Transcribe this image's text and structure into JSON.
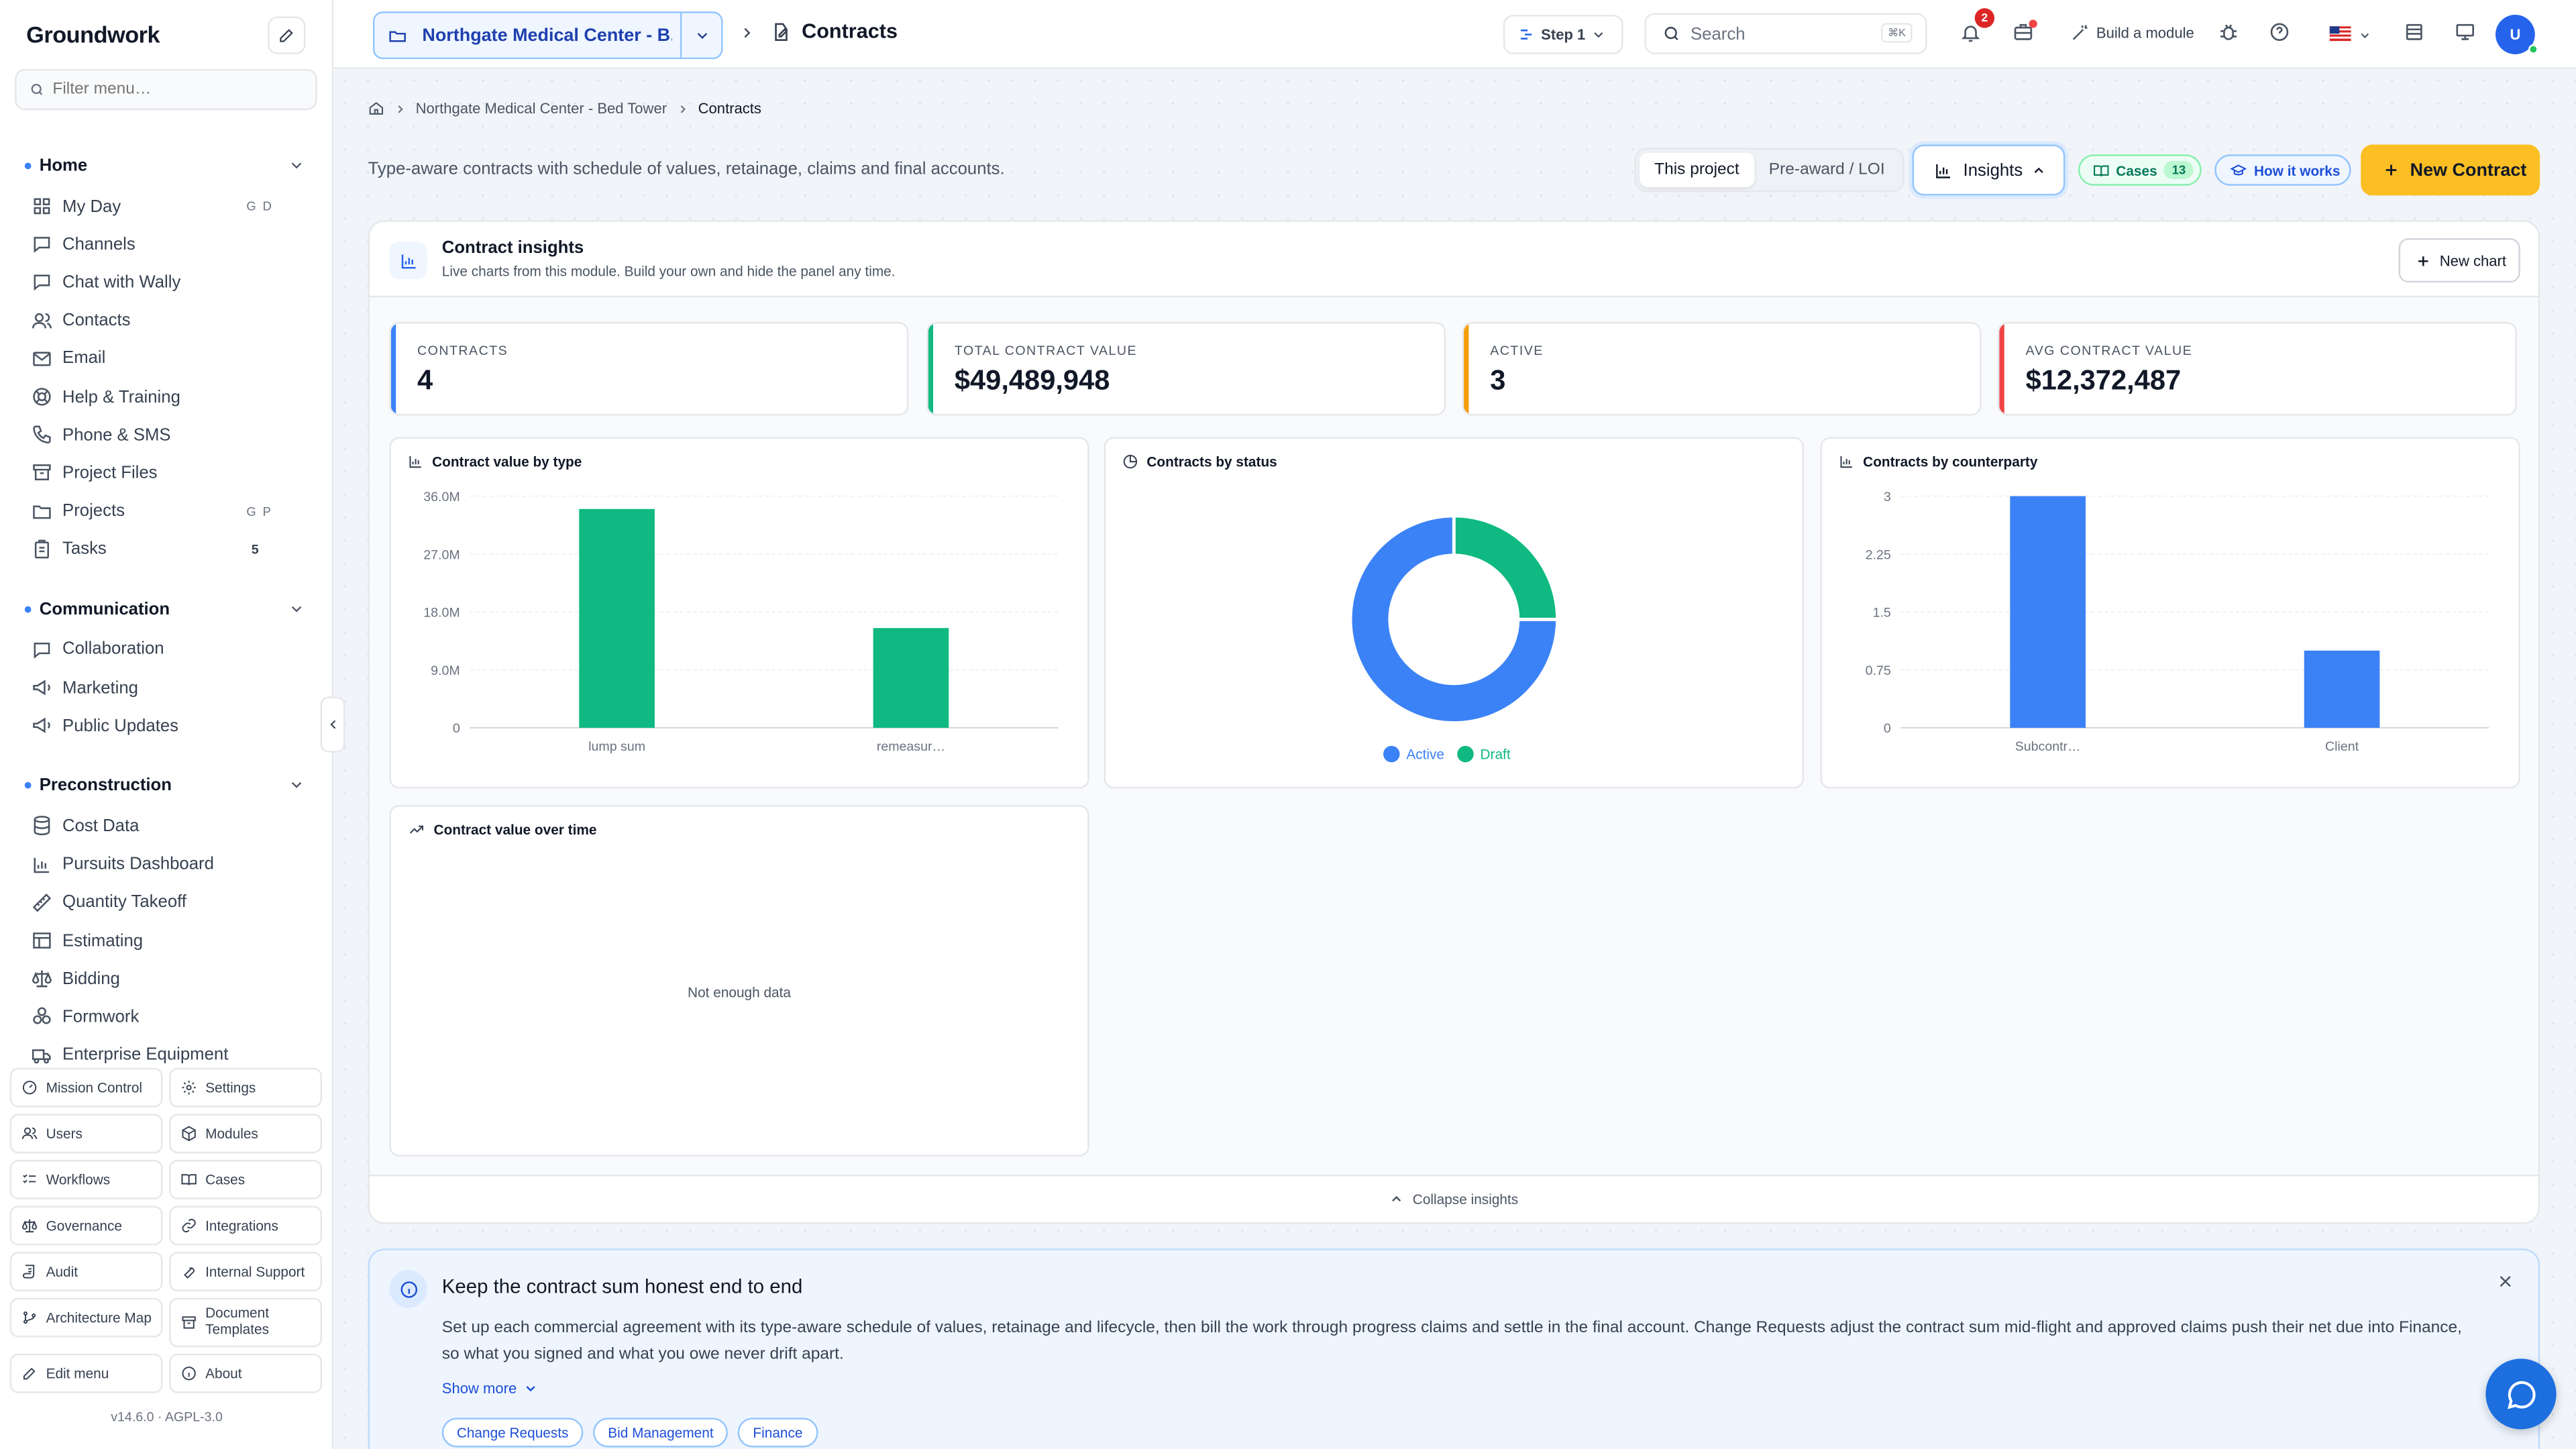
{
  "app": {
    "brand": "Groundwork",
    "version": "v14.6.0",
    "license": "AGPL-3.0"
  },
  "sidebar": {
    "filter_placeholder": "Filter menu…",
    "sections": [
      {
        "title": "Home",
        "items": [
          {
            "label": "My Day",
            "icon": "grid-icon",
            "kbd": "G D"
          },
          {
            "label": "Channels",
            "icon": "chat-icon"
          },
          {
            "label": "Chat with Wally",
            "icon": "chat-icon"
          },
          {
            "label": "Contacts",
            "icon": "users-icon"
          },
          {
            "label": "Email",
            "icon": "mail-icon"
          },
          {
            "label": "Help & Training",
            "icon": "lifebuoy-icon"
          },
          {
            "label": "Phone & SMS",
            "icon": "phone-icon"
          },
          {
            "label": "Project Files",
            "icon": "archive-icon"
          },
          {
            "label": "Projects",
            "icon": "folder-icon",
            "kbd": "G P"
          },
          {
            "label": "Tasks",
            "icon": "clipboard-icon",
            "count": "5"
          }
        ]
      },
      {
        "title": "Communication",
        "items": [
          {
            "label": "Collaboration",
            "icon": "chat-icon"
          },
          {
            "label": "Marketing",
            "icon": "megaphone-icon"
          },
          {
            "label": "Public Updates",
            "icon": "megaphone-icon"
          }
        ]
      },
      {
        "title": "Preconstruction",
        "items": [
          {
            "label": "Cost Data",
            "icon": "database-icon"
          },
          {
            "label": "Pursuits Dashboard",
            "icon": "bar-chart-icon"
          },
          {
            "label": "Quantity Takeoff",
            "icon": "ruler-icon"
          },
          {
            "label": "Estimating",
            "icon": "table-icon"
          },
          {
            "label": "Bidding",
            "icon": "scale-icon"
          },
          {
            "label": "Formwork",
            "icon": "blocks-icon"
          },
          {
            "label": "Enterprise Equipment",
            "icon": "truck-icon"
          }
        ]
      }
    ],
    "bottom_buttons": [
      {
        "label": "Mission Control",
        "icon": "gauge-icon"
      },
      {
        "label": "Settings",
        "icon": "gear-icon"
      },
      {
        "label": "Users",
        "icon": "users-icon"
      },
      {
        "label": "Modules",
        "icon": "box-icon"
      },
      {
        "label": "Workflows",
        "icon": "list-check-icon"
      },
      {
        "label": "Cases",
        "icon": "book-icon"
      },
      {
        "label": "Governance",
        "icon": "scale-icon"
      },
      {
        "label": "Integrations",
        "icon": "link-icon"
      },
      {
        "label": "Audit",
        "icon": "scroll-icon"
      },
      {
        "label": "Internal Support",
        "icon": "wrench-icon"
      },
      {
        "label": "Architecture Map",
        "icon": "git-icon"
      },
      {
        "label": "Document Templates",
        "icon": "archive-icon"
      },
      {
        "label": "Edit menu",
        "icon": "pencil-icon"
      },
      {
        "label": "About",
        "icon": "info-icon"
      }
    ]
  },
  "topbar": {
    "project": "Northgate Medical Center - B...",
    "page_title": "Contracts",
    "step": "Step 1",
    "search_placeholder": "Search",
    "search_kbd": "⌘K",
    "notifications_count": "2",
    "build_module": "Build a module"
  },
  "main": {
    "breadcrumb": [
      "Northgate Medical Center - Bed Tower",
      "Contracts"
    ],
    "subtitle": "Type-aware contracts with schedule of values, retainage, claims and final accounts.",
    "tabs": [
      {
        "label": "This project",
        "active": true
      },
      {
        "label": "Pre-award / LOI",
        "active": false
      }
    ],
    "insights_label": "Insights",
    "cases_label": "Cases",
    "cases_count": "13",
    "how_it_works": "How it works",
    "new_contract": "New Contract"
  },
  "insights": {
    "title": "Contract insights",
    "subtitle": "Live charts from this module. Build your own and hide the panel any time.",
    "new_chart": "New chart",
    "collapse": "Collapse insights",
    "kpis": [
      {
        "label": "CONTRACTS",
        "value": "4",
        "color": "#3b82f6"
      },
      {
        "label": "TOTAL CONTRACT VALUE",
        "value": "$49,489,948",
        "color": "#10b981"
      },
      {
        "label": "ACTIVE",
        "value": "3",
        "color": "#f59e0b"
      },
      {
        "label": "AVG CONTRACT VALUE",
        "value": "$12,372,487",
        "color": "#ef4444"
      }
    ],
    "charts": {
      "by_type_title": "Contract value by type",
      "by_status_title": "Contracts by status",
      "by_counterparty_title": "Contracts by counterparty",
      "over_time_title": "Contract value over time",
      "not_enough_data": "Not enough data"
    }
  },
  "chart_data": [
    {
      "type": "bar",
      "title": "Contract value by type",
      "categories": [
        "lump sum",
        "remeasur…"
      ],
      "values": [
        34000000,
        15500000
      ],
      "yticks": [
        "0",
        "9.0M",
        "18.0M",
        "27.0M",
        "36.0M"
      ],
      "ylim": [
        0,
        36000000
      ],
      "color": "#10b981"
    },
    {
      "type": "pie",
      "title": "Contracts by status",
      "categories": [
        "Active",
        "Draft"
      ],
      "values": [
        3,
        1
      ],
      "colors": [
        "#3b82f6",
        "#10b981"
      ]
    },
    {
      "type": "bar",
      "title": "Contracts by counterparty",
      "categories": [
        "Subcontr…",
        "Client"
      ],
      "values": [
        3,
        1
      ],
      "yticks": [
        "0",
        "0.75",
        "1.5",
        "2.25",
        "3"
      ],
      "ylim": [
        0,
        3
      ],
      "color": "#3b82f6"
    }
  ],
  "info_banner": {
    "title": "Keep the contract sum honest end to end",
    "body": "Set up each commercial agreement with its type-aware schedule of values, retainage and lifecycle, then bill the work through progress claims and settle in the final account. Change Requests adjust the contract sum mid-flight and approved claims push their net due into Finance, so what you signed and what you owe never drift apart.",
    "show_more": "Show more",
    "chips": [
      "Change Requests",
      "Bid Management",
      "Finance"
    ]
  }
}
